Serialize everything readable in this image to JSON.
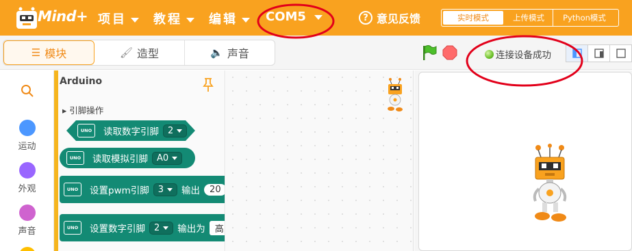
{
  "app": {
    "logo_text": "Mind+"
  },
  "menu": {
    "project": "项目",
    "tutorial": "教程",
    "edit": "编辑",
    "port": "COM5",
    "feedback": "意见反馈"
  },
  "modes": {
    "realtime": "实时模式",
    "upload": "上传模式",
    "python": "Python模式"
  },
  "tabs": {
    "blocks": "模块",
    "costumes": "造型",
    "sounds": "声音"
  },
  "status": {
    "connected": "连接设备成功"
  },
  "categories": [
    {
      "label": "运动",
      "color": "#4c97ff"
    },
    {
      "label": "外观",
      "color": "#9966ff"
    },
    {
      "label": "声音",
      "color": "#cf63cf"
    }
  ],
  "palette": {
    "title": "Arduino",
    "group": "引脚操作",
    "blocks": [
      {
        "uno": "UNO",
        "text": "读取数字引脚",
        "dd": "2"
      },
      {
        "uno": "UNO",
        "text": "读取模拟引脚",
        "dd": "A0"
      },
      {
        "uno": "UNO",
        "text": "设置pwm引脚",
        "dd": "3",
        "text2": "输出",
        "value": "20"
      },
      {
        "uno": "UNO",
        "text": "设置数字引脚",
        "dd": "2",
        "text2": "输出为",
        "value": "高"
      }
    ]
  },
  "colors": {
    "accent": "#f9a21f",
    "block_green": "#138a74",
    "annotation_red": "#e2001a",
    "status_green": "#6cc12b"
  }
}
